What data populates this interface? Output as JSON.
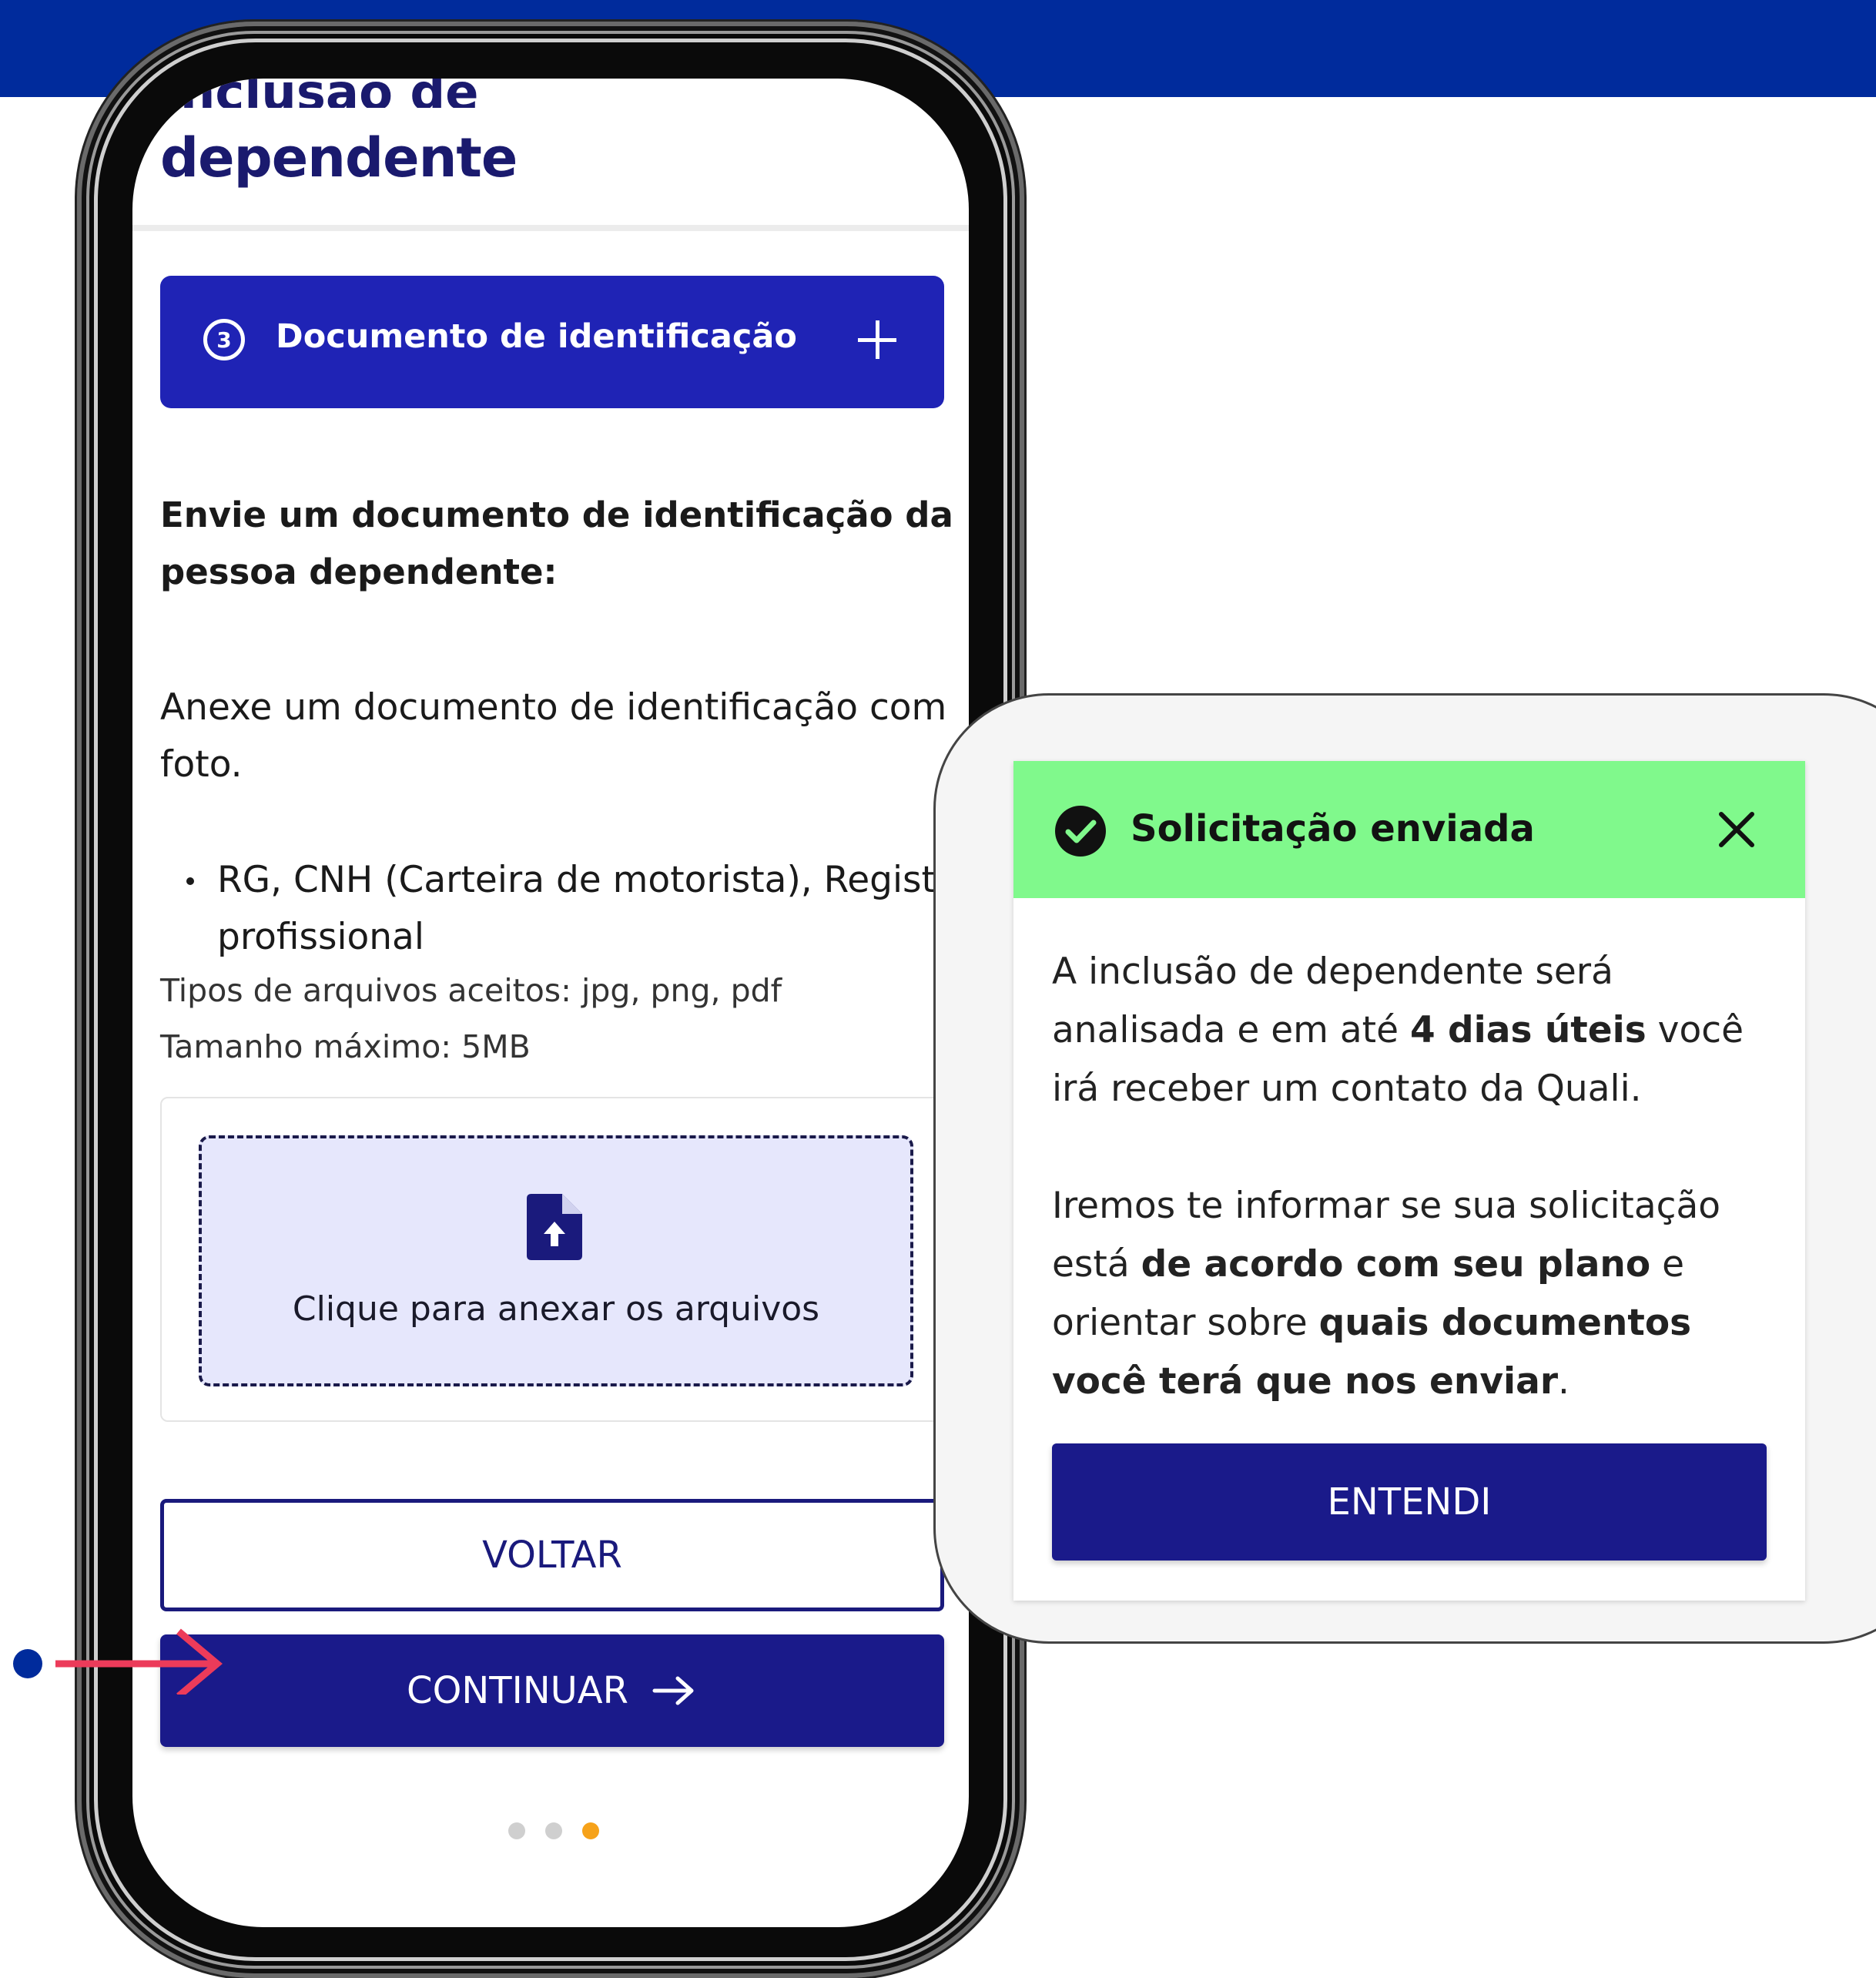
{
  "phone": {
    "title_top_partial": "Inclusão de",
    "title": "dependente",
    "step": {
      "number": "3",
      "label": "Documento de identificação"
    },
    "lead": "Envie um documento de identificação da pessoa dependente:",
    "body": "Anexe um documento de identificação com foto.",
    "bullet_line1": "RG, CNH (Carteira de motorista), Registro",
    "bullet_line2": "profissional",
    "file_types": "Tipos de arquivos aceitos: jpg, png, pdf",
    "max_size": "Tamanho máximo: 5MB",
    "upload_label": "Clique para anexar os arquivos",
    "back_label": "VOLTAR",
    "continue_label": "CONTINUAR",
    "pagination": {
      "total": 3,
      "active": 3
    }
  },
  "modal": {
    "title": "Solicitação enviada",
    "p1_a": "A inclusão de dependente será analisada e em até ",
    "p1_b": "4 dias úteis",
    "p1_c": " você irá receber um contato da Quali.",
    "p2_a": "Iremos te informar se sua solicitação está ",
    "p2_b": "de acordo com seu plano",
    "p2_c": " e orientar sobre ",
    "p2_d": "quais documentos você terá que nos enviar",
    "p2_e": ".",
    "ok_label": "ENTENDI"
  },
  "colors": {
    "brand_blue": "#002b9c",
    "step_blue": "#1f23b5",
    "button_navy": "#1a1a8a",
    "success_green": "#80f98c",
    "active_dot": "#f6a21a"
  }
}
